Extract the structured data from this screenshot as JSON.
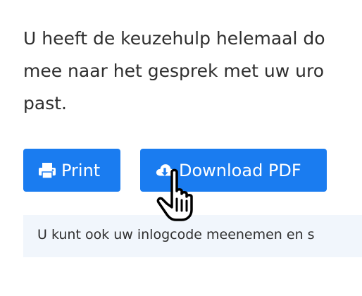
{
  "intro": {
    "line1": "U heeft de keuzehulp helemaal do",
    "line2": "mee naar het gesprek met uw uro",
    "line3": "past."
  },
  "buttons": {
    "print_label": "Print",
    "print_icon": "printer-icon",
    "download_label": "Download PDF",
    "download_icon": "cloud-download-icon"
  },
  "note": {
    "text": "U kunt ook uw inlogcode meenemen en s"
  },
  "colors": {
    "accent": "#1a7cf0",
    "note_background": "#f1f6fc",
    "text": "#2f2f2f"
  },
  "cursor": "hand-pointer-icon"
}
